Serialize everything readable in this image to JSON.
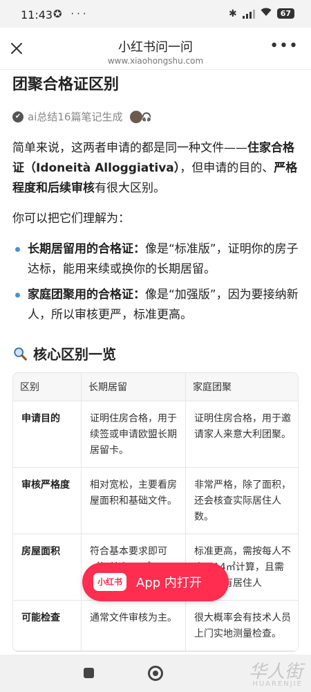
{
  "status": {
    "time": "11:43",
    "battery": "67"
  },
  "nav": {
    "title": "小红书问一问",
    "url": "www.xiaohongshu.com"
  },
  "heading": "团聚合格证区别",
  "source": {
    "text": "ai总结16篇笔记生成"
  },
  "intro": {
    "a": "简单来说，这两者申请的都是同一种文件——",
    "b": "住家合格证（Idoneità Alloggiativa）",
    "c": "，但申请的目的、",
    "d": "严格程度和后续审核",
    "e": "有很大区别。"
  },
  "understand": "你可以把它们理解为：",
  "bullets": [
    {
      "label": "长期居留用的合格证：",
      "text": "像是“标准版”，证明你的房子达标，能用来续或换你的长期居留。"
    },
    {
      "label": "家庭团聚用的合格证：",
      "text": "像是“加强版”，因为要接纳新人，所以审核更严，标准更高。"
    }
  ],
  "section_title": "核心区别一览",
  "table": {
    "headers": [
      "区别",
      "长期居留",
      "家庭团聚"
    ],
    "rows": [
      [
        "申请目的",
        "证明住房合格，用于续签或申请欧盟长期居留卡。",
        "证明住房合格，用于邀请家人来意大利团聚。"
      ],
      [
        "审核严格度",
        "相对宽松，主要看房屋面积和基础文件。",
        "非常严格，除了面积，还会核查实际居住人数。"
      ],
      [
        "房屋面积",
        "符合基本要求即可（如单人28㎡，双",
        "标准更高，需按每人不少于14㎡计算，且需考虑现有居住人"
      ],
      [
        "可能检查",
        "通常文件审核为主。",
        "很大概率会有技术人员上门实地测量检查。"
      ]
    ]
  },
  "app_button": {
    "logo": "小红书",
    "label": "App 内打开"
  },
  "watermark": {
    "cn": "华人街",
    "en": "HUARENJIE"
  }
}
